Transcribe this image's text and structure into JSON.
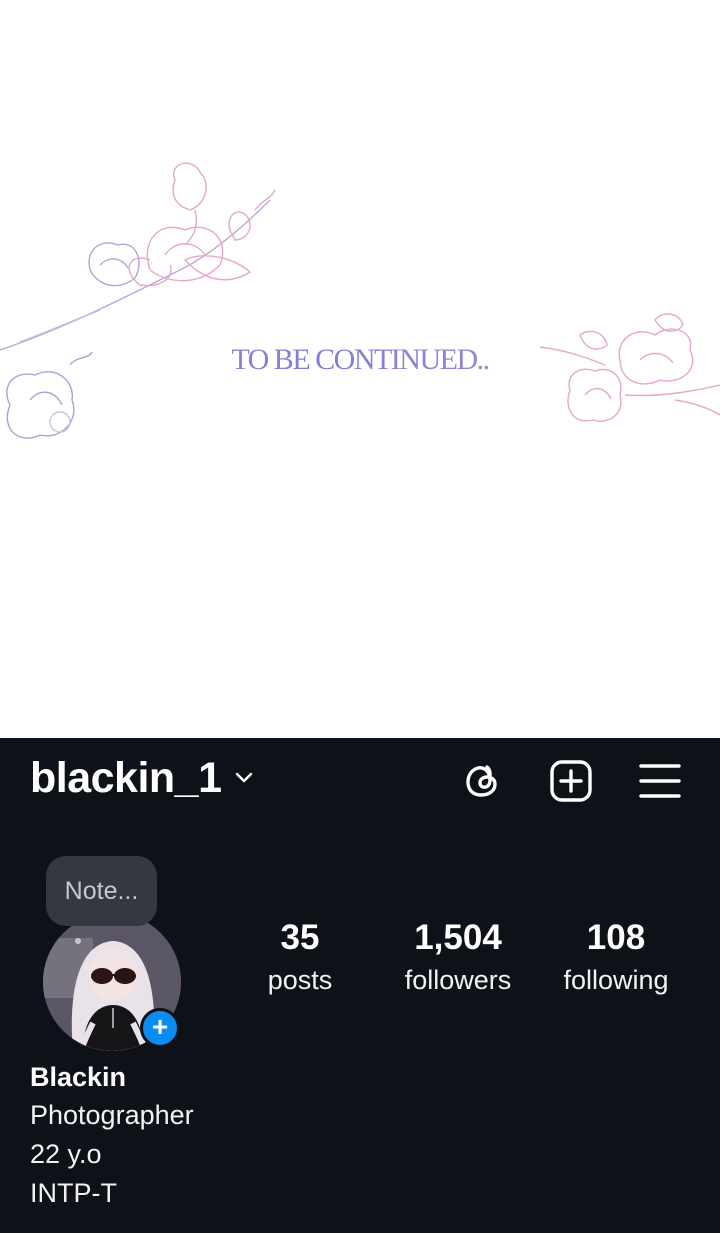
{
  "banner": {
    "text": "TO BE CONTINUED..",
    "colors": {
      "pink": "#e7a6cf",
      "lavender": "#a9a2d8",
      "gradient_start": "#b87ad8",
      "gradient_end": "#c48ad0"
    }
  },
  "profile": {
    "username": "blackin_1",
    "icons": [
      "chevron-down-icon",
      "threads-icon",
      "add-post-icon",
      "menu-icon"
    ],
    "note_placeholder": "Note...",
    "stats": {
      "posts": {
        "value": "35",
        "label": "posts"
      },
      "followers": {
        "value": "1,504",
        "label": "followers"
      },
      "following": {
        "value": "108",
        "label": "following"
      }
    },
    "bio": {
      "name": "Blackin",
      "line1": "Photographer",
      "line2": "22 y.o",
      "line3": "INTP-T"
    },
    "colors": {
      "background": "#0e1117",
      "accent_blue": "#0a8cf0",
      "note_bg": "#353840"
    }
  }
}
